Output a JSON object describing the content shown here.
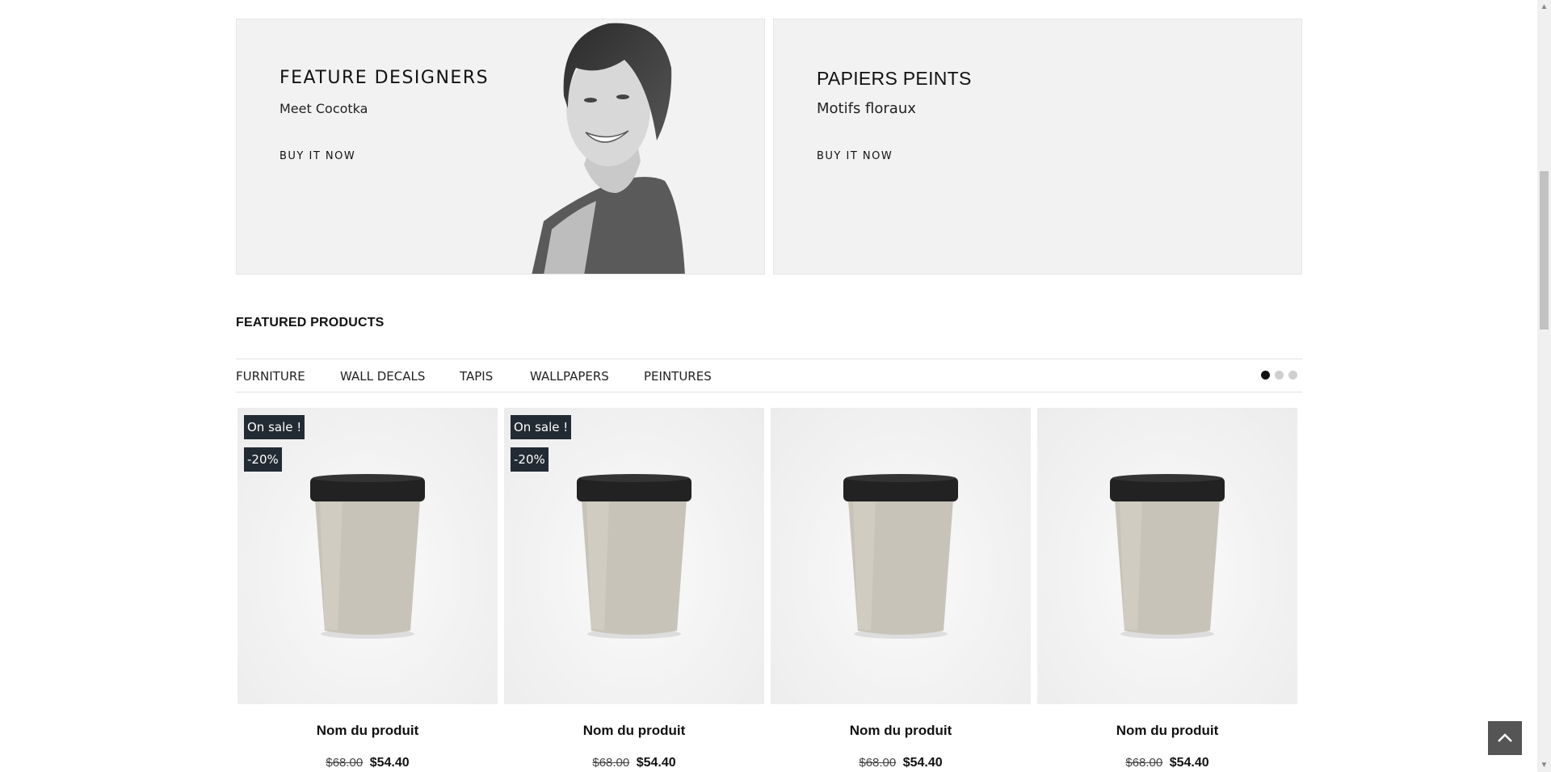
{
  "banners": [
    {
      "title": "FEATURE DESIGNERS",
      "subtitle": "Meet Cocotka",
      "cta": "BUY IT NOW"
    },
    {
      "title": "PAPIERS PEINTS",
      "subtitle": "Motifs floraux",
      "cta": "BUY IT NOW"
    }
  ],
  "featured": {
    "title": "FEATURED PRODUCTS",
    "tabs": [
      "FURNITURE",
      "WALL DECALS",
      "TAPIS",
      "WALLPAPERS",
      "PEINTURES"
    ],
    "pagination": {
      "pages": 3,
      "active": 1
    }
  },
  "products": [
    {
      "name": "Nom du produit",
      "old_price": "$68.00",
      "price": "$54.40",
      "badges": [
        "On sale !",
        "-20%"
      ]
    },
    {
      "name": "Nom du produit",
      "old_price": "$68.00",
      "price": "$54.40",
      "badges": [
        "On sale !",
        "-20%"
      ]
    },
    {
      "name": "Nom du produit",
      "old_price": "$68.00",
      "price": "$54.40",
      "badges": []
    },
    {
      "name": "Nom du produit",
      "old_price": "$68.00",
      "price": "$54.40",
      "badges": []
    }
  ],
  "icons": {
    "back_to_top": "chevron-up-icon"
  },
  "colors": {
    "banner_bg": "#f2f2f2",
    "badge_bg": "#222a33",
    "cup_body": "#c8c3b8",
    "cup_lid": "#222222"
  }
}
